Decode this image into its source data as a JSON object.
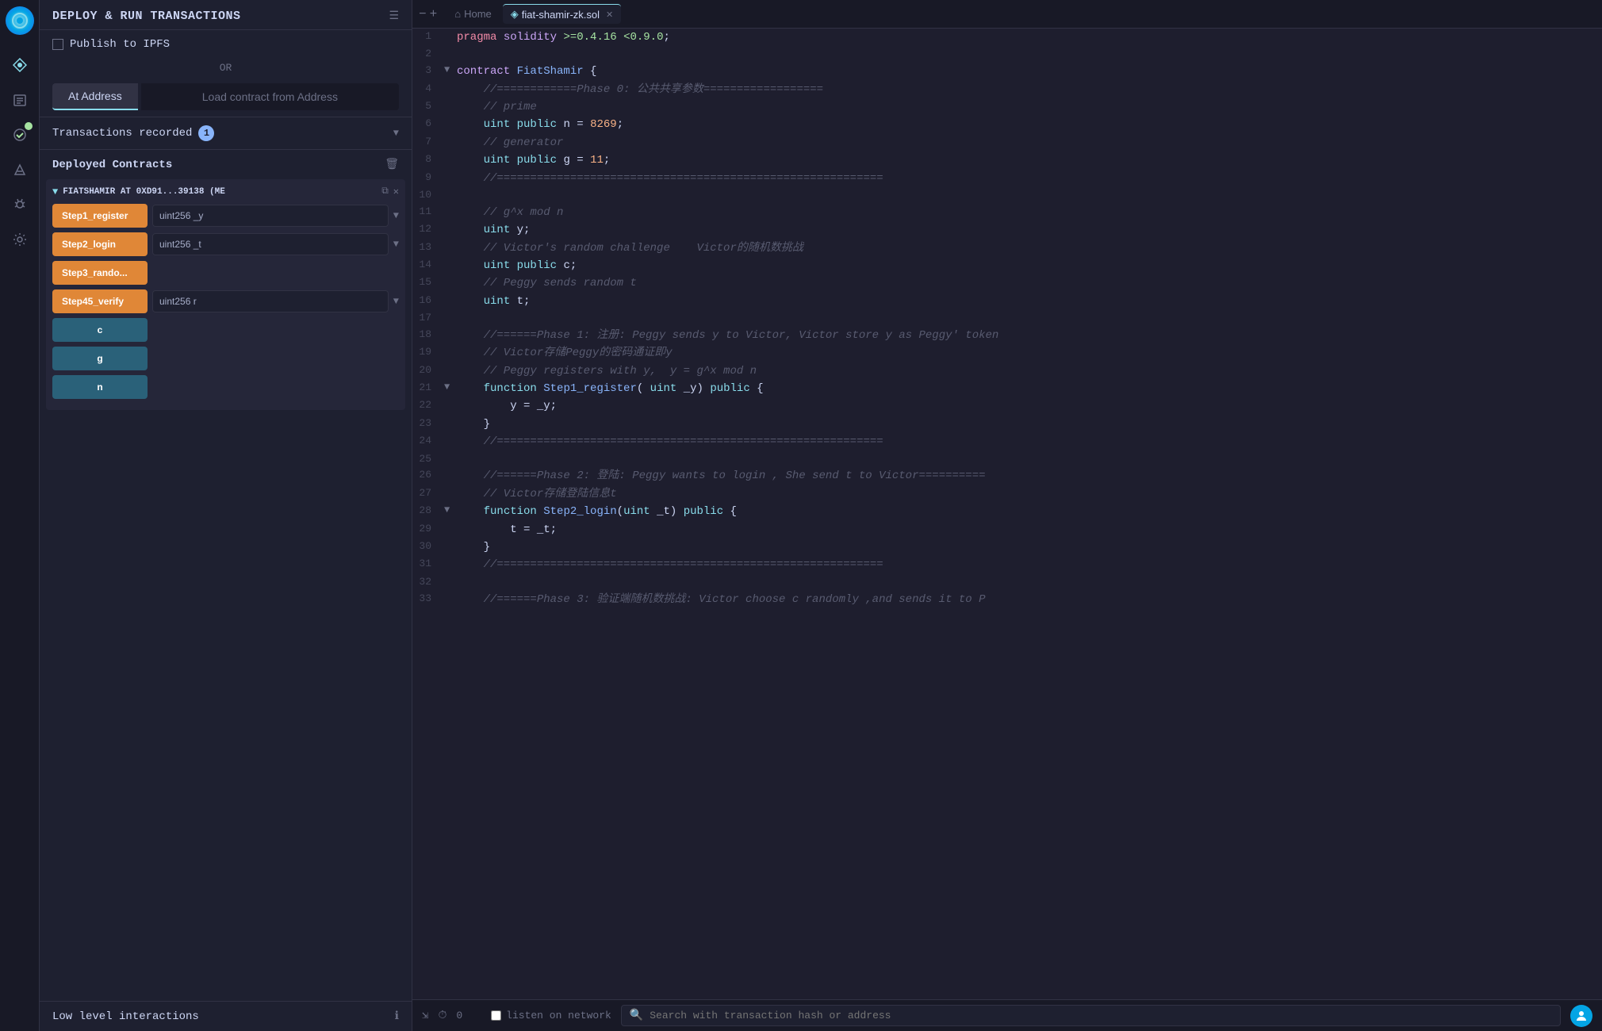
{
  "app": {
    "title": "DEPLOY & RUN TRANSACTIONS"
  },
  "sidebar": {
    "icons": [
      "🌐",
      "📋",
      "⚙️",
      "🐛",
      "🔧"
    ]
  },
  "panel": {
    "title": "DEPLOY & RUN TRANSACTIONS",
    "publish_label": "Publish to IPFS",
    "or_label": "OR",
    "at_address_btn": "At Address",
    "load_contract_btn": "Load contract from Address",
    "transactions_label": "Transactions recorded",
    "transactions_count": "1",
    "deployed_contracts_label": "Deployed Contracts",
    "contract_instance": "FIATSHAMIR AT 0XD91...39138 (ME",
    "functions": [
      {
        "name": "Step1_register",
        "param": "uint256 _y",
        "has_dropdown": true
      },
      {
        "name": "Step2_login",
        "param": "uint256 _t",
        "has_dropdown": true
      },
      {
        "name": "Step3_rando...",
        "param": "",
        "has_dropdown": false
      },
      {
        "name": "Step45_verify",
        "param": "uint256 r",
        "has_dropdown": true
      }
    ],
    "view_functions": [
      {
        "name": "c"
      },
      {
        "name": "g"
      },
      {
        "name": "n"
      }
    ],
    "low_level_label": "Low level interactions"
  },
  "tabs": {
    "home": "Home",
    "file": "fiat-shamir-zk.sol"
  },
  "code": {
    "lines": [
      {
        "num": 1,
        "arrow": "",
        "content": "pragma solidity >=0.4.16 <0.9.0;"
      },
      {
        "num": 2,
        "arrow": "",
        "content": ""
      },
      {
        "num": 3,
        "arrow": "▼",
        "content": "contract FiatShamir {"
      },
      {
        "num": 4,
        "arrow": "",
        "content": "    //============Phase 0: 公共共享参数=================="
      },
      {
        "num": 5,
        "arrow": "",
        "content": "    // prime"
      },
      {
        "num": 6,
        "arrow": "",
        "content": "    uint public n = 8269;"
      },
      {
        "num": 7,
        "arrow": "",
        "content": "    // generator"
      },
      {
        "num": 8,
        "arrow": "",
        "content": "    uint public g = 11;"
      },
      {
        "num": 9,
        "arrow": "",
        "content": "    //=========================================================="
      },
      {
        "num": 10,
        "arrow": "",
        "content": ""
      },
      {
        "num": 11,
        "arrow": "",
        "content": "    // g^x mod n"
      },
      {
        "num": 12,
        "arrow": "",
        "content": "    uint y;"
      },
      {
        "num": 13,
        "arrow": "",
        "content": "    // Victor's random challenge    Victor的随机数挑战"
      },
      {
        "num": 14,
        "arrow": "",
        "content": "    uint public c;"
      },
      {
        "num": 15,
        "arrow": "",
        "content": "    // Peggy sends random t"
      },
      {
        "num": 16,
        "arrow": "",
        "content": "    uint t;"
      },
      {
        "num": 17,
        "arrow": "",
        "content": ""
      },
      {
        "num": 18,
        "arrow": "",
        "content": "    //======Phase 1: 注册: Peggy sends y to Victor, Victor store y as Peggy' token"
      },
      {
        "num": 19,
        "arrow": "",
        "content": "    // Victor存储Peggy的密码通证即y"
      },
      {
        "num": 20,
        "arrow": "",
        "content": "    // Peggy registers with y,  y = g^x mod n"
      },
      {
        "num": 21,
        "arrow": "▼",
        "content": "    function Step1_register( uint _y) public {"
      },
      {
        "num": 22,
        "arrow": "",
        "content": "        y = _y;"
      },
      {
        "num": 23,
        "arrow": "",
        "content": "    }"
      },
      {
        "num": 24,
        "arrow": "",
        "content": "    //=========================================================="
      },
      {
        "num": 25,
        "arrow": "",
        "content": ""
      },
      {
        "num": 26,
        "arrow": "",
        "content": "    //======Phase 2: 登陆: Peggy wants to login , She send t to Victor=========="
      },
      {
        "num": 27,
        "arrow": "",
        "content": "    // Victor存储登陆信息t"
      },
      {
        "num": 28,
        "arrow": "▼",
        "content": "    function Step2_login(uint _t) public {"
      },
      {
        "num": 29,
        "arrow": "",
        "content": "        t = _t;"
      },
      {
        "num": 30,
        "arrow": "",
        "content": "    }"
      },
      {
        "num": 31,
        "arrow": "",
        "content": "    //=========================================================="
      },
      {
        "num": 32,
        "arrow": "",
        "content": ""
      },
      {
        "num": 33,
        "arrow": "",
        "content": "    //======Phase 3: 验证端随机数挑战: Victor choose c randomly ,and sends it to P"
      }
    ]
  },
  "bottom_bar": {
    "count": "0",
    "listen_label": "listen on network",
    "search_placeholder": "Search with transaction hash or address"
  }
}
